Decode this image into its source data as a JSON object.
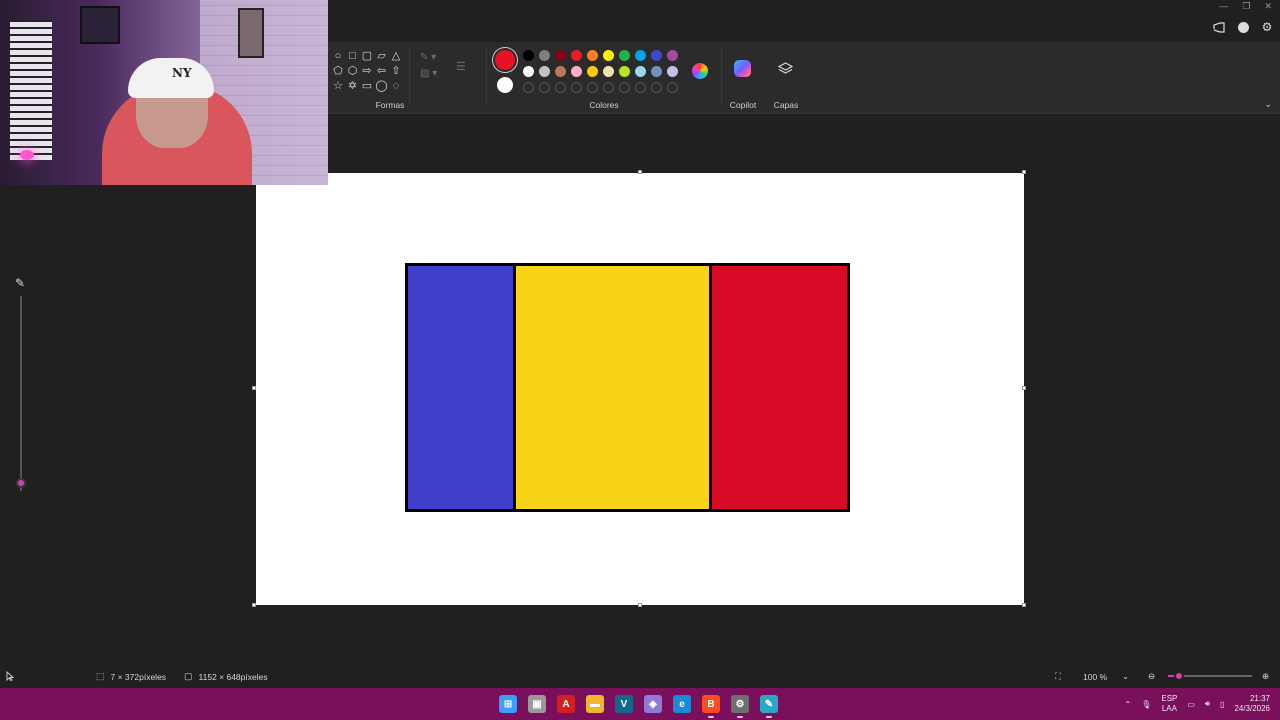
{
  "window": {
    "controls": [
      "—",
      "❐",
      "✕"
    ]
  },
  "header_icons": [
    "share-icon",
    "account-icon",
    "settings-icon"
  ],
  "ribbon": {
    "shapes": {
      "label": "Formas",
      "items": [
        "○",
        "□",
        "▢",
        "▱",
        "△",
        "⬠",
        "⬡",
        "⇨",
        "⇦",
        "⇧",
        "☆",
        "✡",
        "▭",
        "◯",
        "◌"
      ]
    },
    "colors": {
      "label": "Colores",
      "primary": "#e81224",
      "secondary": "#ffffff",
      "palette_row1": [
        "#000000",
        "#7f7f7f",
        "#880015",
        "#ed1c24",
        "#ff7f27",
        "#fff200",
        "#22b14c",
        "#00a2e8",
        "#3f48cc",
        "#a349a4"
      ],
      "palette_row2": [
        "#ffffff",
        "#c3c3c3",
        "#b97a57",
        "#ffaec9",
        "#ffc90e",
        "#efe4b0",
        "#b5e61d",
        "#99d9ea",
        "#7092be",
        "#c8bfe7"
      ],
      "palette_row3_count": 10
    },
    "copilot": {
      "label": "Copilot"
    },
    "layers": {
      "label": "Capas"
    }
  },
  "canvas": {
    "background": "#ffffff",
    "flag_stripes": [
      {
        "color": "#3f3fc9",
        "share": 0.24
      },
      {
        "color": "#f8d318",
        "share": 0.445
      },
      {
        "color": "#d90a25",
        "share": 0.315
      }
    ]
  },
  "brush_size": {
    "level": 0.04
  },
  "status": {
    "selection_size": "7 × 372píxeles",
    "canvas_size": "1152 × 648píxeles",
    "zoom": "100 %",
    "zoom_level": 0.13
  },
  "taskbar": {
    "apps": [
      {
        "name": "start",
        "glyph": "⊞",
        "color": "#3aa0ff"
      },
      {
        "name": "file-manager",
        "glyph": "▣",
        "color": "#9a9a9a"
      },
      {
        "name": "pdf-reader",
        "glyph": "A",
        "color": "#d4201c"
      },
      {
        "name": "folder",
        "glyph": "▬",
        "color": "#f2b632"
      },
      {
        "name": "visual-studio",
        "glyph": "V",
        "color": "#0e6a8c"
      },
      {
        "name": "app-diamond",
        "glyph": "◈",
        "color": "#8e7bd6"
      },
      {
        "name": "edge",
        "glyph": "e",
        "color": "#1a8ad6"
      },
      {
        "name": "brave",
        "glyph": "B",
        "color": "#ff4c1f"
      },
      {
        "name": "app-cog",
        "glyph": "⚙",
        "color": "#6f6f6f"
      },
      {
        "name": "paint",
        "glyph": "✎",
        "color": "#2aa7c9"
      }
    ],
    "tray": {
      "lang_top": "ESP",
      "lang_bottom": "LAA",
      "time": "21:37",
      "date": "24/3/2026"
    }
  }
}
